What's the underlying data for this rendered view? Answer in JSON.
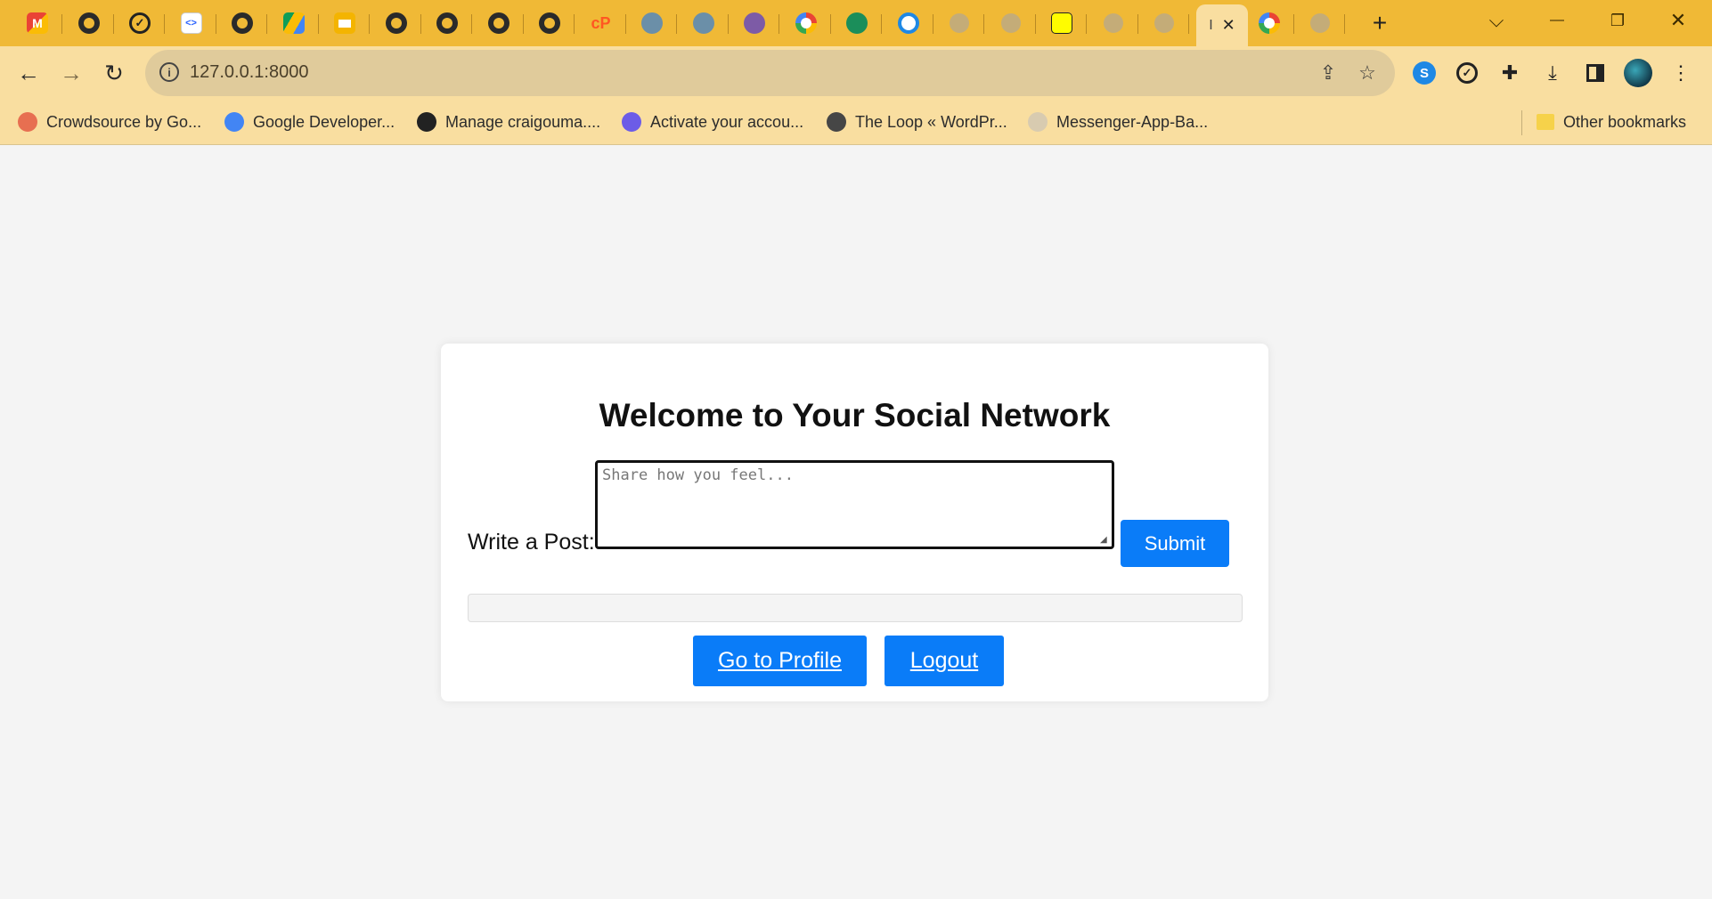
{
  "browser": {
    "tabs": [
      {
        "icon": "gmail-icon",
        "kind": "gmail"
      },
      {
        "icon": "github-icon",
        "kind": "github"
      },
      {
        "icon": "checkmark-circle-icon",
        "kind": "check"
      },
      {
        "icon": "code-app-icon",
        "kind": "code"
      },
      {
        "icon": "github-icon",
        "kind": "github"
      },
      {
        "icon": "google-drive-icon",
        "kind": "drive"
      },
      {
        "icon": "google-slides-icon",
        "kind": "slides"
      },
      {
        "icon": "github-icon",
        "kind": "github"
      },
      {
        "icon": "github-icon",
        "kind": "github"
      },
      {
        "icon": "github-icon",
        "kind": "github"
      },
      {
        "icon": "github-icon",
        "kind": "github"
      },
      {
        "icon": "codepen-icon",
        "kind": "cp"
      },
      {
        "icon": "app-icon",
        "kind": "app"
      },
      {
        "icon": "app-icon",
        "kind": "app"
      },
      {
        "icon": "planet-icon",
        "kind": "planet"
      },
      {
        "icon": "google-icon",
        "kind": "google"
      },
      {
        "icon": "recycle-icon",
        "kind": "recycle"
      },
      {
        "icon": "blue-circle-icon",
        "kind": "bluec"
      },
      {
        "icon": "globe-icon",
        "kind": "globe"
      },
      {
        "icon": "globe-icon",
        "kind": "globe"
      },
      {
        "icon": "snapchat-icon",
        "kind": "snap"
      },
      {
        "icon": "globe-icon",
        "kind": "globe"
      },
      {
        "icon": "globe-icon",
        "kind": "globe"
      }
    ],
    "active_tab": {
      "title_fragment": "I",
      "close_glyph": "✕"
    },
    "after_tabs": [
      {
        "icon": "google-icon",
        "kind": "google"
      },
      {
        "icon": "globe-icon",
        "kind": "globe"
      }
    ],
    "new_tab_glyph": "+",
    "window_controls": {
      "tab_search": "⌵",
      "minimize": "—",
      "restore": "❐",
      "close": "✕"
    },
    "nav": {
      "back": "←",
      "forward": "→",
      "reload": "↻"
    },
    "url": "127.0.0.1:8000",
    "info_glyph": "i",
    "bookmarks": [
      {
        "label": "Crowdsource by Go...",
        "color": "#e76f51"
      },
      {
        "label": "Google Developer...",
        "color": "#4285f4"
      },
      {
        "label": "Manage craigouma....",
        "color": "#222222"
      },
      {
        "label": "Activate your accou...",
        "color": "#6c5ce7"
      },
      {
        "label": "The Loop « WordPr...",
        "color": "#464646"
      },
      {
        "label": "Messenger-App-Ba...",
        "color": "#d8cbb0"
      }
    ],
    "other_bookmarks": "Other bookmarks"
  },
  "page": {
    "heading": "Welcome to Your Social Network",
    "post_label": "Write a Post:",
    "post_placeholder": "Share how you feel...",
    "submit_label": "Submit",
    "profile_label": "Go to Profile",
    "logout_label": "Logout"
  },
  "colors": {
    "chrome": "#f0b936",
    "toolbar": "#f9dea0",
    "primary": "#0a7cf8"
  }
}
